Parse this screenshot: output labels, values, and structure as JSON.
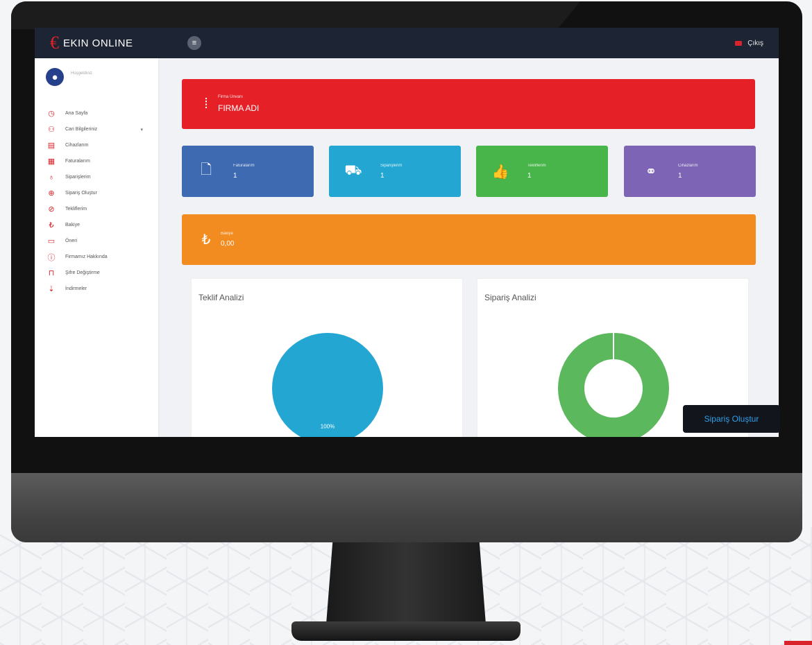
{
  "brand": {
    "logo": "€",
    "name": "EKIN ONLINE"
  },
  "header": {
    "menu_icon": "hamburger-icon",
    "logout_label": "Çıkış"
  },
  "user": {
    "name": "Hoşgeldiniz"
  },
  "sidebar": {
    "items": [
      {
        "icon": "clock-icon",
        "glyph": "◷",
        "label": "Ana Sayfa"
      },
      {
        "icon": "users-icon",
        "glyph": "⚇",
        "label": "Cari Bilgileriniz",
        "caret": "▾"
      },
      {
        "icon": "invoice-icon",
        "glyph": "▤",
        "label": "Cihazlarım"
      },
      {
        "icon": "calendar-icon",
        "glyph": "▦",
        "label": "Faturalarım"
      },
      {
        "icon": "thumbs-up-icon",
        "glyph": "♁",
        "label": "Siparişlerim"
      },
      {
        "icon": "plus-circle-icon",
        "glyph": "⊕",
        "label": "Sipariş Oluştur"
      },
      {
        "icon": "check-circle-icon",
        "glyph": "⊘",
        "label": "Tekliflerim"
      },
      {
        "icon": "lira-icon",
        "glyph": "₺",
        "label": "Bakiye"
      },
      {
        "icon": "ticket-icon",
        "glyph": "▭",
        "label": "Öneri"
      },
      {
        "icon": "info-icon",
        "glyph": "ⓘ",
        "label": "Firmamız Hakkında"
      },
      {
        "icon": "lock-icon",
        "glyph": "⊓",
        "label": "Şifre Değiştirme"
      },
      {
        "icon": "download-icon",
        "glyph": "⇣",
        "label": "İndirmeler"
      }
    ]
  },
  "cards": {
    "firm": {
      "icon": "building-icon",
      "glyph": "⁞",
      "label": "Firma Ünvanı",
      "value": "FIRMA ADI"
    },
    "invoices": {
      "icon": "document-icon",
      "glyph": "🗋",
      "label": "Faturalarım",
      "value": "1"
    },
    "orders": {
      "icon": "truck-icon",
      "glyph": "⛟",
      "label": "Siparişlerim",
      "value": "1"
    },
    "offers": {
      "icon": "thumbs-up-icon",
      "glyph": "👍",
      "label": "Tekliflerim",
      "value": "1"
    },
    "devices": {
      "icon": "link-icon",
      "glyph": "⚭",
      "label": "Cihazlarım",
      "value": "1"
    },
    "balance": {
      "icon": "lira-icon",
      "glyph": "₺",
      "label": "Bakiye",
      "value": "0,00"
    }
  },
  "panels": {
    "offer_analysis": {
      "title": "Teklif Analizi"
    },
    "order_analysis": {
      "title": "Sipariş Analizi"
    }
  },
  "chart_data": [
    {
      "type": "pie",
      "title": "Teklif Analizi",
      "values": [
        100
      ],
      "labels": [
        "100%"
      ],
      "colors": [
        "#23a7d2"
      ]
    },
    {
      "type": "pie",
      "title": "Sipariş Analizi",
      "values": [
        100
      ],
      "colors": [
        "#5cb85c"
      ]
    }
  ],
  "actions": {
    "create_order": "Sipariş Oluştur"
  },
  "colors": {
    "accent": "#d8232a",
    "topbar": "#1d2433"
  }
}
